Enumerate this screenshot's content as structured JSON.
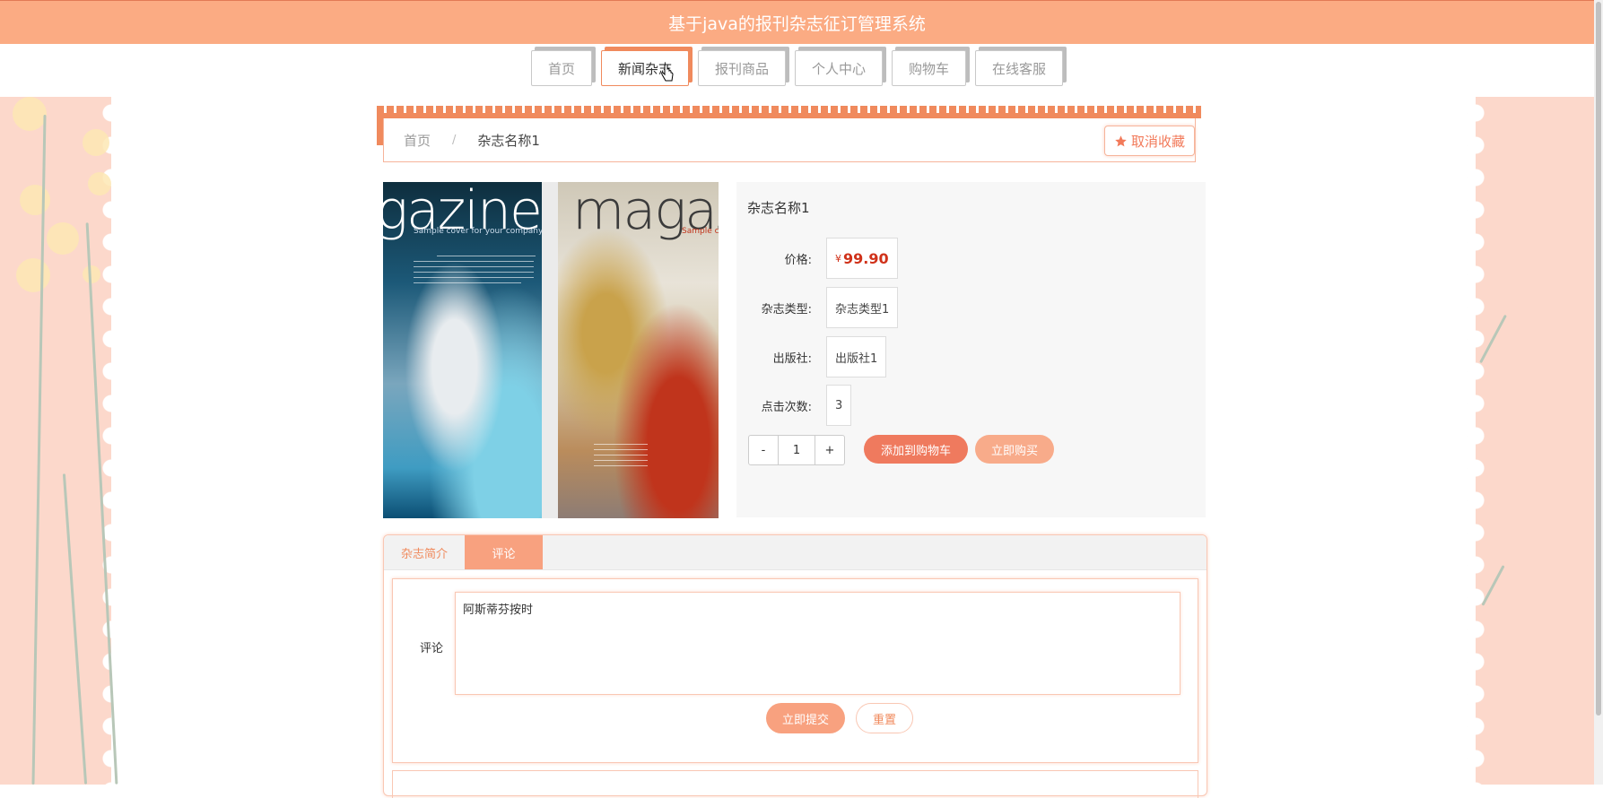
{
  "header": {
    "title": "基于java的报刊杂志征订管理系统"
  },
  "nav": {
    "items": [
      {
        "label": "首页"
      },
      {
        "label": "新闻杂志"
      },
      {
        "label": "报刊商品"
      },
      {
        "label": "个人中心"
      },
      {
        "label": "购物车"
      },
      {
        "label": "在线客服"
      }
    ],
    "active_index": 1
  },
  "breadcrumb": {
    "home": "首页",
    "separator": "/",
    "current": "杂志名称1"
  },
  "favorite_button": {
    "label": "取消收藏",
    "icon": "star-icon"
  },
  "images": [
    {
      "title": "gazine",
      "subtitle": "Sample cover for your company"
    },
    {
      "title": "magaz",
      "subtitle": "Sample co"
    }
  ],
  "product": {
    "name": "杂志名称1",
    "price_label": "价格:",
    "price_currency": "¥",
    "price_value": "99.90",
    "type_label": "杂志类型:",
    "type_value": "杂志类型1",
    "publisher_label": "出版社:",
    "publisher_value": "出版社1",
    "clicks_label": "点击次数:",
    "clicks_value": "3",
    "qty_minus": "-",
    "qty_value": "1",
    "qty_plus": "+",
    "add_to_cart": "添加到购物车",
    "buy_now": "立即购买"
  },
  "tabs": [
    {
      "label": "杂志简介"
    },
    {
      "label": "评论"
    }
  ],
  "comment": {
    "label": "评论",
    "text": "阿斯蒂芬按时",
    "submit": "立即提交",
    "reset": "重置"
  },
  "colors": {
    "accent": "#fbab83",
    "primary": "#ef7a5e",
    "price": "#d0321a"
  }
}
